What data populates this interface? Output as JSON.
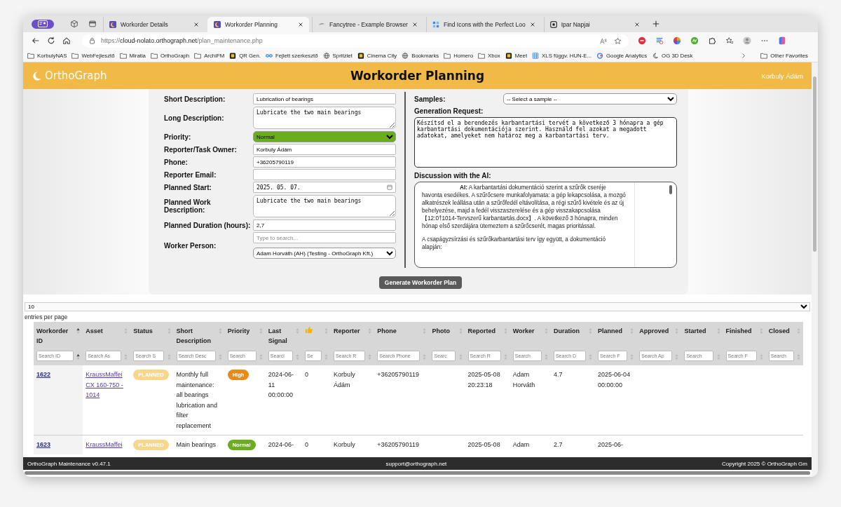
{
  "browser": {
    "tabs": [
      {
        "title": "Workorder Details",
        "kind": "moon",
        "selected": false
      },
      {
        "title": "Workorder Planning",
        "kind": "moon",
        "selected": true
      },
      {
        "title": "Fancytree - Example Browser",
        "kind": "leaf",
        "selected": false
      },
      {
        "title": "Find Icons with the Perfect Loo",
        "kind": "grid",
        "selected": false
      },
      {
        "title": "Ipar Napjai",
        "kind": "square",
        "selected": false
      }
    ],
    "url_scheme": "https://",
    "url_host": "cloud-nolato.orthograph.net",
    "url_path": "/plan_maintenance.php",
    "bookmarks": [
      {
        "label": "KorbulyNAS",
        "kind": "folder"
      },
      {
        "label": "WebFejlesztő",
        "kind": "folder"
      },
      {
        "label": "Miratia",
        "kind": "folder"
      },
      {
        "label": "OrthoGraph",
        "kind": "folder"
      },
      {
        "label": "ArchiFM",
        "kind": "folder"
      },
      {
        "label": "QR Gen.",
        "kind": "square"
      },
      {
        "label": "Fejlett szerkesztő",
        "kind": "loop"
      },
      {
        "label": "Spritzlet",
        "kind": "globe"
      },
      {
        "label": "Cinema City",
        "kind": "square"
      },
      {
        "label": "Bookmarks",
        "kind": "globe"
      },
      {
        "label": "Homero",
        "kind": "folder"
      },
      {
        "label": "Xbox",
        "kind": "folder"
      },
      {
        "label": "Meet",
        "kind": "square"
      },
      {
        "label": "XLS függv. HUN-E...",
        "kind": "grid"
      },
      {
        "label": "Google Analytics",
        "kind": "circle"
      },
      {
        "label": "OG 3D Desk",
        "kind": "moon"
      }
    ],
    "other_favorites": "Other Favorites"
  },
  "app": {
    "brand": "OrthoGraph",
    "title": "Workorder Planning",
    "user": "Korbuly Ádám"
  },
  "form": {
    "fields": [
      {
        "label": "Short Description:",
        "kind": "text",
        "value": "Lubrication of bearings"
      },
      {
        "label": "Long Description:",
        "kind": "textarea",
        "value": "Lubricate the two main bearings"
      },
      {
        "label": "Priority:",
        "kind": "select",
        "value": "Normal",
        "color": "#6aae20"
      },
      {
        "label": "Reporter/Task Owner:",
        "kind": "text",
        "value": "Korbuly Ádám"
      },
      {
        "label": "Phone:",
        "kind": "text",
        "value": "+36205790119"
      },
      {
        "label": "Reporter Email:",
        "kind": "text"
      },
      {
        "label": "Planned Start:",
        "kind": "date",
        "value": "2025. 05. 07."
      },
      {
        "label": "Planned Work Description:",
        "kind": "textarea",
        "value": "Lubricate the two main bearings"
      },
      {
        "label": "Planned Duration (hours):",
        "kind": "text",
        "value": "2,7"
      },
      {
        "label": "Worker Person:",
        "kind": "search-select",
        "placeholder": "Type to search...",
        "value": "Adam Horváth (AH) (Testing - OrthoGraph Kft.)"
      }
    ],
    "samples": {
      "label": "Samples:",
      "placeholder": "-- Select a sample --"
    },
    "request": {
      "label": "Generation Request:",
      "value": "Készítsd el a berendezés karbantartási tervét a következő 3 hónapra a gép karbantartási dokumentációja szerint. Használd fel azokat a megadott adatokat, amelyeket nem határoz meg a karbantartási terv."
    },
    "discussion": {
      "label": "Discussion with the AI:",
      "paragraphs": [
        "**AI:** A karbantartási dokumentáció szerint a szűrők cseréje havonta esedékes. A szűrőcsere munkafolyamata: a gép lekapcsolása, a mozgó alkatrészek leállása után a szűrőfedél eltávolítása, a régi szűrő kivétele és az új behelyezése, majd a fedél visszaszerelése és a gép visszakapcsolása【12:0†1014-Tervszerű karbantartás.docx】. A következő 3 hónapra, minden hónap első szerdájára ütemeztem a szűrőcserét, magas prioritással.",
        "A csapágyzsírzási és szűrőkarbantartási terv így együtt, a dokumentáció alapján:"
      ]
    },
    "generate_button": "Generate Workorder Plan"
  },
  "table": {
    "page_size": "10",
    "page_size_label": "entries per page",
    "columns": [
      {
        "label": "Workorder ID",
        "kind": "text",
        "sorted": true,
        "placeholder": "Search ID"
      },
      {
        "label": "Asset",
        "kind": "text",
        "sorted": false,
        "placeholder": "Search As"
      },
      {
        "label": "Status",
        "kind": "text",
        "sorted": false,
        "placeholder": "Search S"
      },
      {
        "label": "Short Description",
        "kind": "text",
        "sorted": false,
        "placeholder": "Search Desc"
      },
      {
        "label": "Priority",
        "kind": "text",
        "sorted": false,
        "placeholder": "Search"
      },
      {
        "label": "Last Signal",
        "kind": "text",
        "sorted": false,
        "placeholder": "Searcl"
      },
      {
        "kind": "likes",
        "sorted": false,
        "placeholder": "Se"
      },
      {
        "label": "Reporter",
        "kind": "text",
        "sorted": false,
        "placeholder": "Search R"
      },
      {
        "label": "Phone",
        "kind": "text",
        "sorted": false,
        "placeholder": "Search Phone"
      },
      {
        "label": "Photo",
        "kind": "text",
        "sorted": false,
        "placeholder": "Searc"
      },
      {
        "label": "Reported",
        "kind": "text",
        "sorted": false,
        "placeholder": "Search R"
      },
      {
        "label": "Worker",
        "kind": "text",
        "sorted": false,
        "placeholder": "Search"
      },
      {
        "label": "Duration",
        "kind": "text",
        "sorted": false,
        "placeholder": "Search D"
      },
      {
        "label": "Planned",
        "kind": "text",
        "sorted": false,
        "placeholder": "Search F"
      },
      {
        "label": "Approved",
        "kind": "text",
        "sorted": false,
        "placeholder": "Search Ap"
      },
      {
        "label": "Started",
        "kind": "text",
        "sorted": false,
        "placeholder": "Search"
      },
      {
        "label": "Finished",
        "kind": "text",
        "sorted": false,
        "placeholder": "Search F"
      },
      {
        "label": "Closed",
        "kind": "text",
        "sorted": false,
        "placeholder": "Search"
      }
    ],
    "rows": [
      {
        "id": "1622",
        "asset": "KraussMaffei CX 160-750 - 1014",
        "status": {
          "text": "PLANNED",
          "color": "#f8d78c"
        },
        "short_description": "Monthly full maintenance: all bearings lubrication and filter replacement",
        "priority": {
          "text": "High",
          "color": "#e88a1a"
        },
        "last_signal": "2024-06-11 00:00:00",
        "likes": "0",
        "reporter": "Korbuly Ádám",
        "phone": "+36205790119",
        "reported": "2025-05-08 20:23:18",
        "worker": "Adam Horváth",
        "duration": "4.7",
        "planned": "2025-06-04 00:00:00"
      },
      {
        "id": "1623",
        "asset": "KraussMaffei",
        "status": {
          "text": "PLANNED",
          "color": "#f8d78c"
        },
        "short_description": "Main bearings",
        "priority": {
          "text": "Normal",
          "color": "#6aae20"
        },
        "last_signal": "2024-06-",
        "likes": "0",
        "reporter": "Korbuly",
        "phone": "+36205790119",
        "reported": "2025-05-08",
        "worker": "Adam",
        "duration": "2.7",
        "planned": "2025-06-"
      }
    ]
  },
  "footer": {
    "version": "OrthoGraph Maintenance v0.47.1",
    "email": "support@orthograph.net",
    "copyright": "Copyright 2025 © OrthoGraph Gm"
  }
}
